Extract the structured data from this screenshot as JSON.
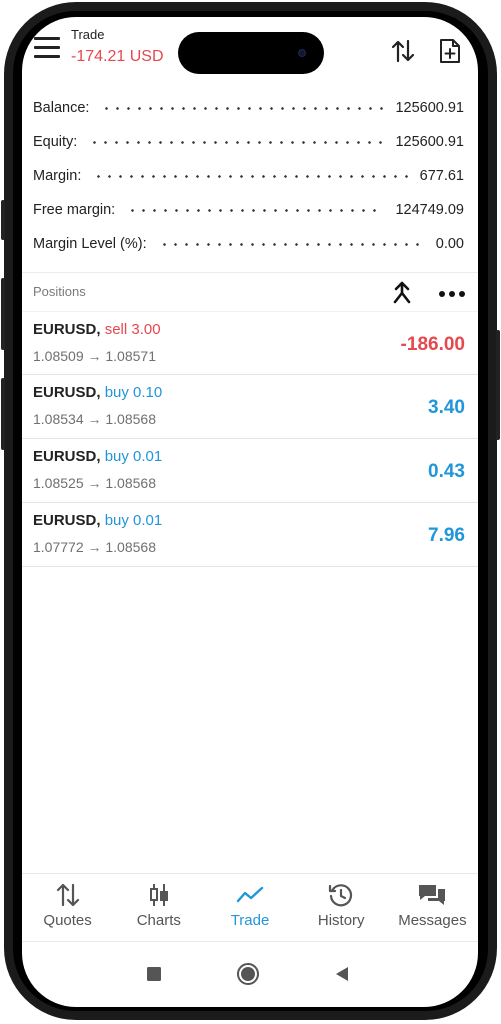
{
  "header": {
    "title": "Trade",
    "total_profit": "-174.21 USD",
    "hamburger_icon": "menu-icon",
    "sort_icon": "sort-arrows-icon",
    "new_order_icon": "new-document-icon"
  },
  "summary": [
    {
      "label": "Balance:",
      "value": "125600.91"
    },
    {
      "label": "Equity:",
      "value": "125600.91"
    },
    {
      "label": "Margin:",
      "value": "677.61"
    },
    {
      "label": "Free margin:",
      "value": "124749.09"
    },
    {
      "label": "Margin Level (%):",
      "value": "0.00"
    }
  ],
  "positions": {
    "title": "Positions",
    "items": [
      {
        "symbol": "EURUSD,",
        "direction": "sell 3.00",
        "side": "sell",
        "prices": "1.08509 → 1.08571",
        "profit": "-186.00"
      },
      {
        "symbol": "EURUSD,",
        "direction": "buy 0.10",
        "side": "buy",
        "prices": "1.08534 → 1.08568",
        "profit": "3.40"
      },
      {
        "symbol": "EURUSD,",
        "direction": "buy 0.01",
        "side": "buy",
        "prices": "1.08525 → 1.08568",
        "profit": "0.43"
      },
      {
        "symbol": "EURUSD,",
        "direction": "buy 0.01",
        "side": "buy",
        "prices": "1.07772 → 1.08568",
        "profit": "7.96"
      }
    ]
  },
  "nav": {
    "items": [
      {
        "label": "Quotes",
        "icon": "quotes-icon"
      },
      {
        "label": "Charts",
        "icon": "candlestick-icon"
      },
      {
        "label": "Trade",
        "icon": "trade-line-icon",
        "active": true
      },
      {
        "label": "History",
        "icon": "history-icon"
      },
      {
        "label": "Messages",
        "icon": "messages-icon"
      }
    ]
  },
  "colors": {
    "accent": "#2196d9",
    "loss": "#e5484d",
    "text": "#222222",
    "muted": "#707070"
  }
}
